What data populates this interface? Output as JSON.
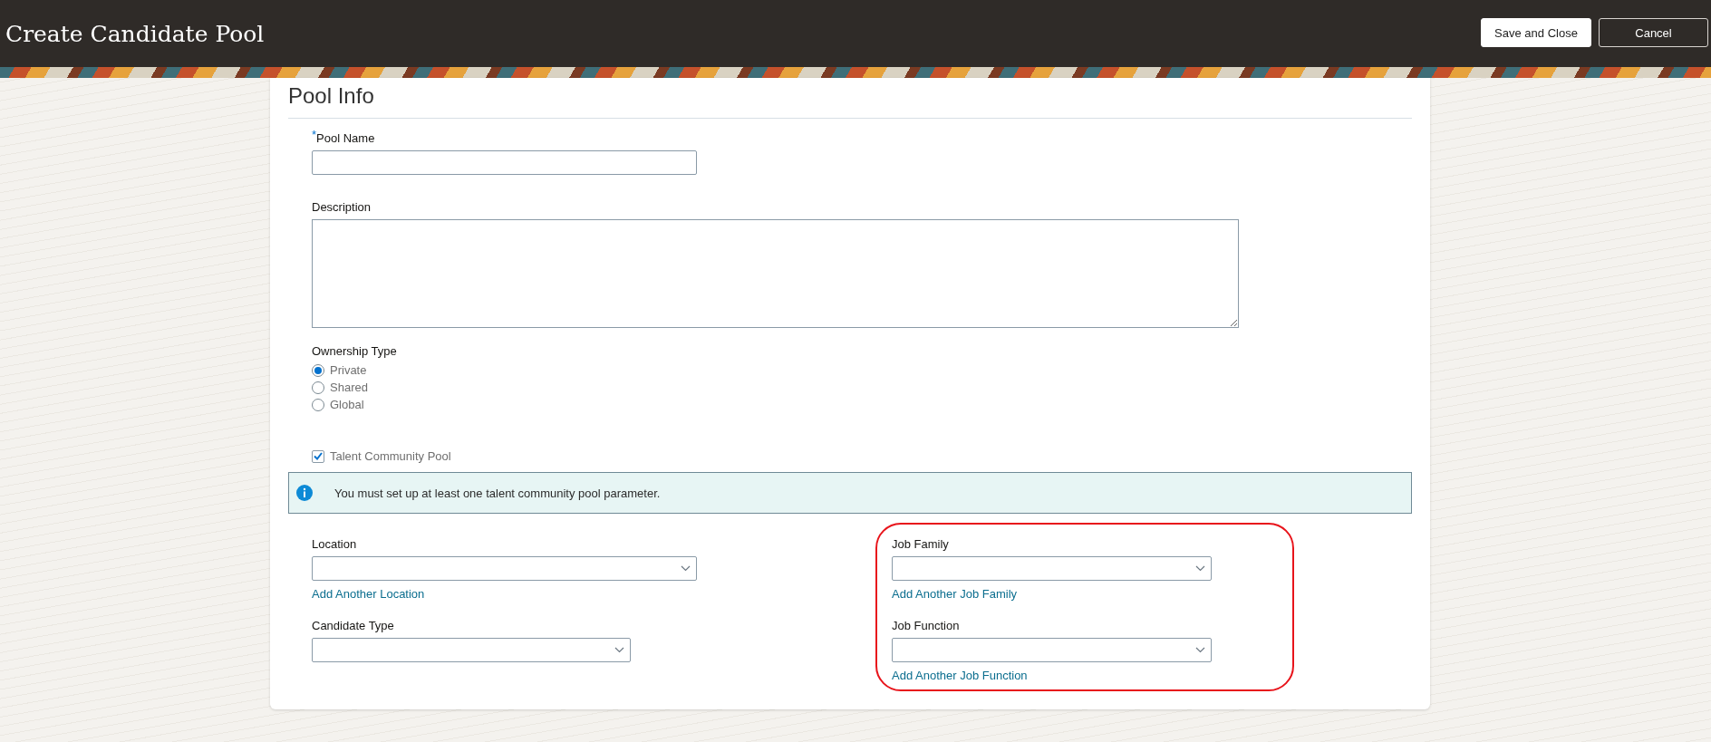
{
  "header": {
    "title": "Create Candidate Pool",
    "buttons": [
      {
        "label": "Save and Close",
        "kind": "primary"
      },
      {
        "label": "Cancel",
        "kind": "secondary"
      }
    ]
  },
  "section": {
    "title": "Pool Info"
  },
  "pool_name": {
    "label": "Pool Name",
    "required": true,
    "required_mark": "*"
  },
  "description": {
    "label": "Description"
  },
  "ownership": {
    "label": "Ownership Type",
    "options": [
      {
        "label": "Private",
        "selected": true
      },
      {
        "label": "Shared",
        "selected": false
      },
      {
        "label": "Global",
        "selected": false
      }
    ]
  },
  "talent_community": {
    "label": "Talent Community Pool",
    "checked": true
  },
  "info_message": "You must set up at least one talent community pool parameter.",
  "parameters": {
    "left": [
      {
        "label": "Location",
        "link": "Add Another Location"
      },
      {
        "label": "Candidate Type"
      }
    ],
    "right": [
      {
        "label": "Job Family",
        "link": "Add Another Job Family"
      },
      {
        "label": "Job Function",
        "link": "Add Another Job Function"
      }
    ],
    "right_highlighted": true
  }
}
